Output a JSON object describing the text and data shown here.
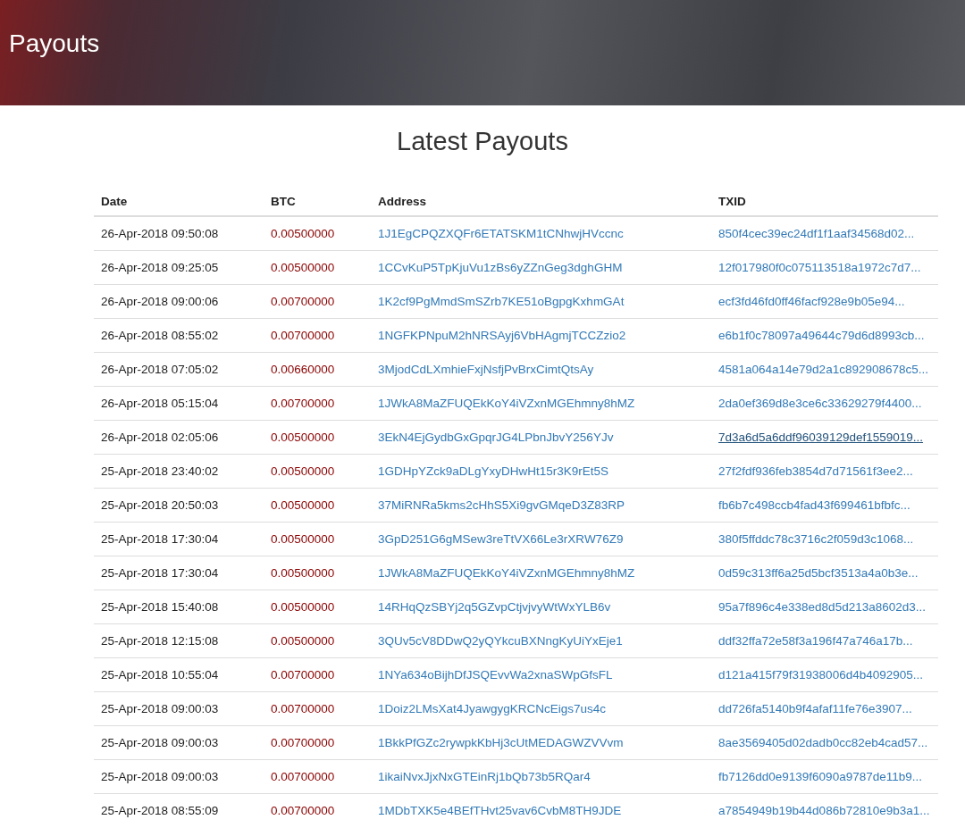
{
  "header": {
    "title": "Payouts"
  },
  "section_title": "Latest Payouts",
  "table": {
    "columns": [
      "Date",
      "BTC",
      "Address",
      "TXID"
    ],
    "rows": [
      {
        "date": "26-Apr-2018 09:50:08",
        "btc": "0.00500000",
        "address": "1J1EgCPQZXQFr6ETATSKM1tCNhwjHVccnc",
        "txid": "850f4cec39ec24df1f1aaf34568d02...",
        "hovered": false
      },
      {
        "date": "26-Apr-2018 09:25:05",
        "btc": "0.00500000",
        "address": "1CCvKuP5TpKjuVu1zBs6yZZnGeg3dghGHM",
        "txid": "12f017980f0c075113518a1972c7d7...",
        "hovered": false
      },
      {
        "date": "26-Apr-2018 09:00:06",
        "btc": "0.00700000",
        "address": "1K2cf9PgMmdSmSZrb7KE51oBgpgKxhmGAt",
        "txid": "ecf3fd46fd0ff46facf928e9b05e94...",
        "hovered": false
      },
      {
        "date": "26-Apr-2018 08:55:02",
        "btc": "0.00700000",
        "address": "1NGFKPNpuM2hNRSAyj6VbHAgmjTCCZzio2",
        "txid": "e6b1f0c78097a49644c79d6d8993cb...",
        "hovered": false
      },
      {
        "date": "26-Apr-2018 07:05:02",
        "btc": "0.00660000",
        "address": "3MjodCdLXmhieFxjNsfjPvBrxCimtQtsAy",
        "txid": "4581a064a14e79d2a1c892908678c5...",
        "hovered": false
      },
      {
        "date": "26-Apr-2018 05:15:04",
        "btc": "0.00700000",
        "address": "1JWkA8MaZFUQEkKoY4iVZxnMGEhmny8hMZ",
        "txid": "2da0ef369d8e3ce6c33629279f4400...",
        "hovered": false
      },
      {
        "date": "26-Apr-2018 02:05:06",
        "btc": "0.00500000",
        "address": "3EkN4EjGydbGxGpqrJG4LPbnJbvY256YJv",
        "txid": "7d3a6d5a6ddf96039129def1559019...",
        "hovered": true
      },
      {
        "date": "25-Apr-2018 23:40:02",
        "btc": "0.00500000",
        "address": "1GDHpYZck9aDLgYxyDHwHt15r3K9rEt5S",
        "txid": "27f2fdf936feb3854d7d71561f3ee2...",
        "hovered": false
      },
      {
        "date": "25-Apr-2018 20:50:03",
        "btc": "0.00500000",
        "address": "37MiRNRa5kms2cHhS5Xi9gvGMqeD3Z83RP",
        "txid": "fb6b7c498ccb4fad43f699461bfbfc...",
        "hovered": false
      },
      {
        "date": "25-Apr-2018 17:30:04",
        "btc": "0.00500000",
        "address": "3GpD251G6gMSew3reTtVX66Le3rXRW76Z9",
        "txid": "380f5ffddc78c3716c2f059d3c1068...",
        "hovered": false
      },
      {
        "date": "25-Apr-2018 17:30:04",
        "btc": "0.00500000",
        "address": "1JWkA8MaZFUQEkKoY4iVZxnMGEhmny8hMZ",
        "txid": "0d59c313ff6a25d5bcf3513a4a0b3e...",
        "hovered": false
      },
      {
        "date": "25-Apr-2018 15:40:08",
        "btc": "0.00500000",
        "address": "14RHqQzSBYj2q5GZvpCtjvjvyWtWxYLB6v",
        "txid": "95a7f896c4e338ed8d5d213a8602d3...",
        "hovered": false
      },
      {
        "date": "25-Apr-2018 12:15:08",
        "btc": "0.00500000",
        "address": "3QUv5cV8DDwQ2yQYkcuBXNngKyUiYxEje1",
        "txid": "ddf32ffa72e58f3a196f47a746a17b...",
        "hovered": false
      },
      {
        "date": "25-Apr-2018 10:55:04",
        "btc": "0.00700000",
        "address": "1NYa634oBijhDfJSQEvvWa2xnaSWpGfsFL",
        "txid": "d121a415f79f31938006d4b4092905...",
        "hovered": false
      },
      {
        "date": "25-Apr-2018 09:00:03",
        "btc": "0.00700000",
        "address": "1Doiz2LMsXat4JyawgygKRCNcEigs7us4c",
        "txid": "dd726fa5140b9f4afaf11fe76e3907...",
        "hovered": false
      },
      {
        "date": "25-Apr-2018 09:00:03",
        "btc": "0.00700000",
        "address": "1BkkPfGZc2rywpkKbHj3cUtMEDAGWZVVvm",
        "txid": "8ae3569405d02dadb0cc82eb4cad57...",
        "hovered": false
      },
      {
        "date": "25-Apr-2018 09:00:03",
        "btc": "0.00700000",
        "address": "1ikaiNvxJjxNxGTEinRj1bQb73b5RQar4",
        "txid": "fb7126dd0e9139f6090a9787de11b9...",
        "hovered": false
      },
      {
        "date": "25-Apr-2018 08:55:09",
        "btc": "0.00700000",
        "address": "1MDbTXK5e4BEfTHvt25vav6CvbM8TH9JDE",
        "txid": "a7854949b19b44d086b72810e9b3a1...",
        "hovered": false
      }
    ]
  }
}
